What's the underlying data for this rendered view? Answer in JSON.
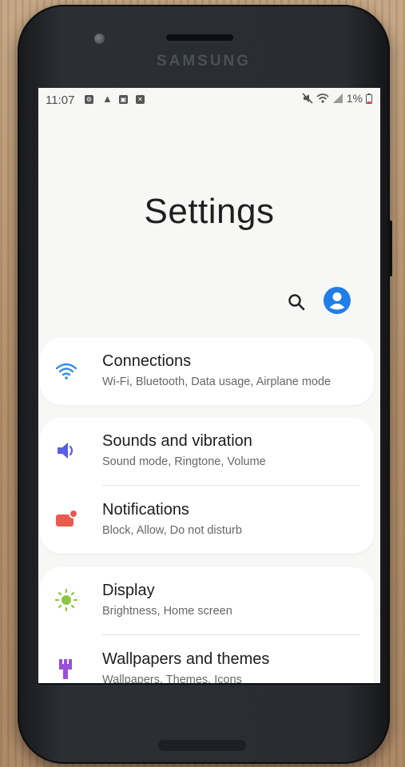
{
  "device": {
    "brand": "SAMSUNG"
  },
  "status_bar": {
    "time": "11:07",
    "battery": "1%",
    "left_icons": [
      "settings-gear-icon",
      "warning-icon",
      "calendar-icon",
      "close-box-icon"
    ],
    "right_icons": [
      "mute-icon",
      "wifi-icon",
      "signal-icon",
      "battery-icon"
    ]
  },
  "header": {
    "title": "Settings"
  },
  "colors": {
    "account_blue": "#1f7ee8",
    "wifi_blue": "#2f8de4",
    "sound_purple": "#5a5fe0",
    "notif_red": "#ea5a4f",
    "display_green": "#8dc63f",
    "wallpaper_purple": "#9a4fd8"
  },
  "items": [
    {
      "label": "Connections",
      "sub": "Wi-Fi, Bluetooth, Data usage, Airplane mode",
      "icon": "wifi-icon"
    },
    {
      "label": "Sounds and vibration",
      "sub": "Sound mode, Ringtone, Volume",
      "icon": "speaker-icon"
    },
    {
      "label": "Notifications",
      "sub": "Block, Allow, Do not disturb",
      "icon": "notification-icon"
    },
    {
      "label": "Display",
      "sub": "Brightness, Home screen",
      "icon": "brightness-icon"
    },
    {
      "label": "Wallpapers and themes",
      "sub": "Wallpapers, Themes, Icons",
      "icon": "paint-brush-icon"
    }
  ]
}
